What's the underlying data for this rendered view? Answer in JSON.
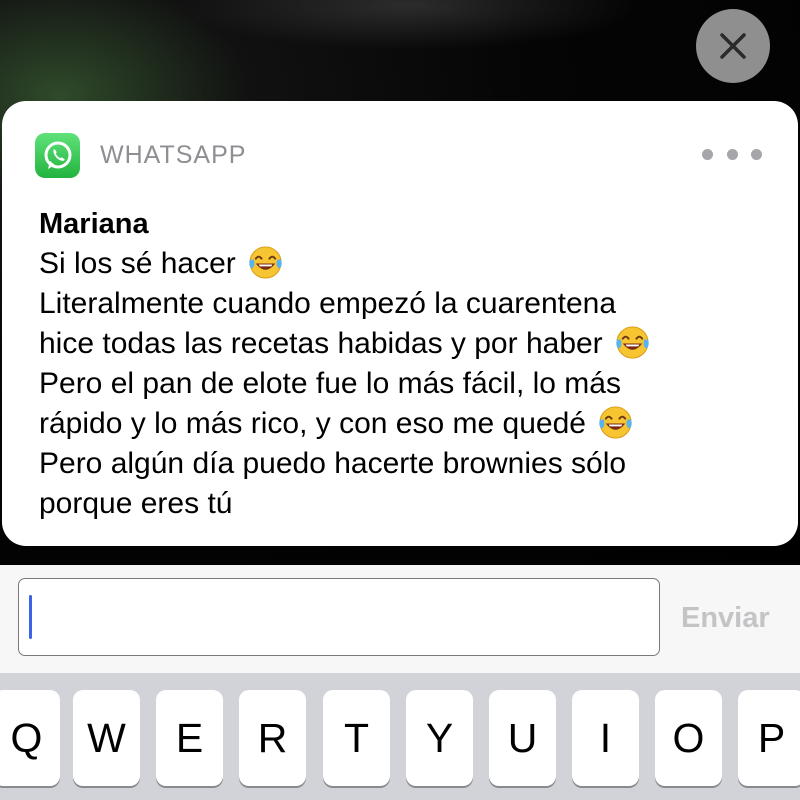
{
  "close_button": {
    "icon": "close-icon"
  },
  "notification": {
    "app_name": "WHATSAPP",
    "app_icon": "whatsapp-icon",
    "more_icon": "more-options-icon",
    "sender": "Mariana",
    "message_lines": [
      {
        "text": "Si los sé hacer",
        "emoji": "😂"
      },
      {
        "text": "Literalmente cuando empezó la cuarentena",
        "emoji": ""
      },
      {
        "text": "hice todas las recetas habidas y por haber",
        "emoji": "😂"
      },
      {
        "text": "Pero el pan de elote fue lo más fácil, lo más",
        "emoji": ""
      },
      {
        "text": "rápido y lo más rico, y con eso me quedé",
        "emoji": "😂"
      },
      {
        "text": "Pero algún día puedo hacerte brownies sólo",
        "emoji": ""
      },
      {
        "text": "porque eres tú",
        "emoji": ""
      }
    ]
  },
  "reply": {
    "input_value": "",
    "input_placeholder": "",
    "send_label": "Enviar"
  },
  "keyboard": {
    "row1": [
      "Q",
      "W",
      "E",
      "R",
      "T",
      "Y",
      "U",
      "I",
      "O",
      "P"
    ]
  },
  "colors": {
    "whatsapp_green": "#25D366",
    "caret_blue": "#3B64E6",
    "send_disabled": "#C4C4C7"
  }
}
